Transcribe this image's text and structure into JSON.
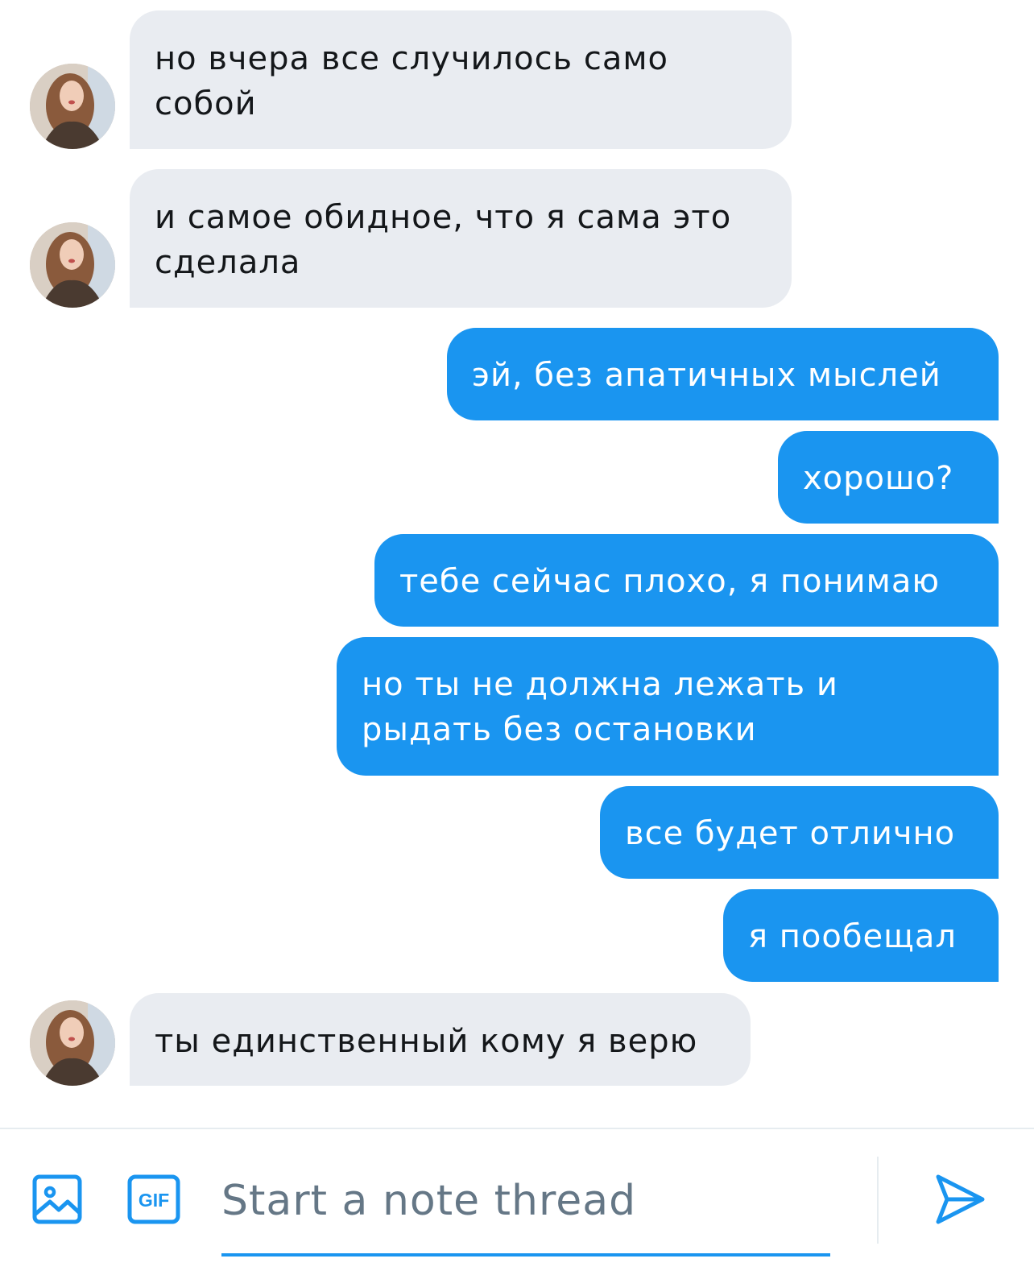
{
  "messages": [
    {
      "dir": "in",
      "text": "но вчера все случилось само\nсобой"
    },
    {
      "dir": "in",
      "text": "и самое обидное, что я сама это\nсделала"
    },
    {
      "dir": "out",
      "text": "эй, без апатичных мыслей"
    },
    {
      "dir": "out",
      "text": "хорошо?"
    },
    {
      "dir": "out",
      "text": "тебе сейчас плохо, я понимаю"
    },
    {
      "dir": "out",
      "text": "но ты не должна лежать и\nрыдать без остановки"
    },
    {
      "dir": "out",
      "text": "все будет отлично"
    },
    {
      "dir": "out",
      "text": "я пообещал"
    },
    {
      "dir": "in",
      "text": "ты единственный кому я верю"
    }
  ],
  "composer": {
    "placeholder": "Start a note thread",
    "gif_label": "GIF",
    "icons": {
      "media": "image-icon",
      "gif": "gif-icon",
      "send": "send-icon"
    }
  },
  "colors": {
    "outgoing_bubble": "#1a95f0",
    "incoming_bubble": "#e9ecf1",
    "accent": "#1a95f0",
    "placeholder": "#657786"
  }
}
